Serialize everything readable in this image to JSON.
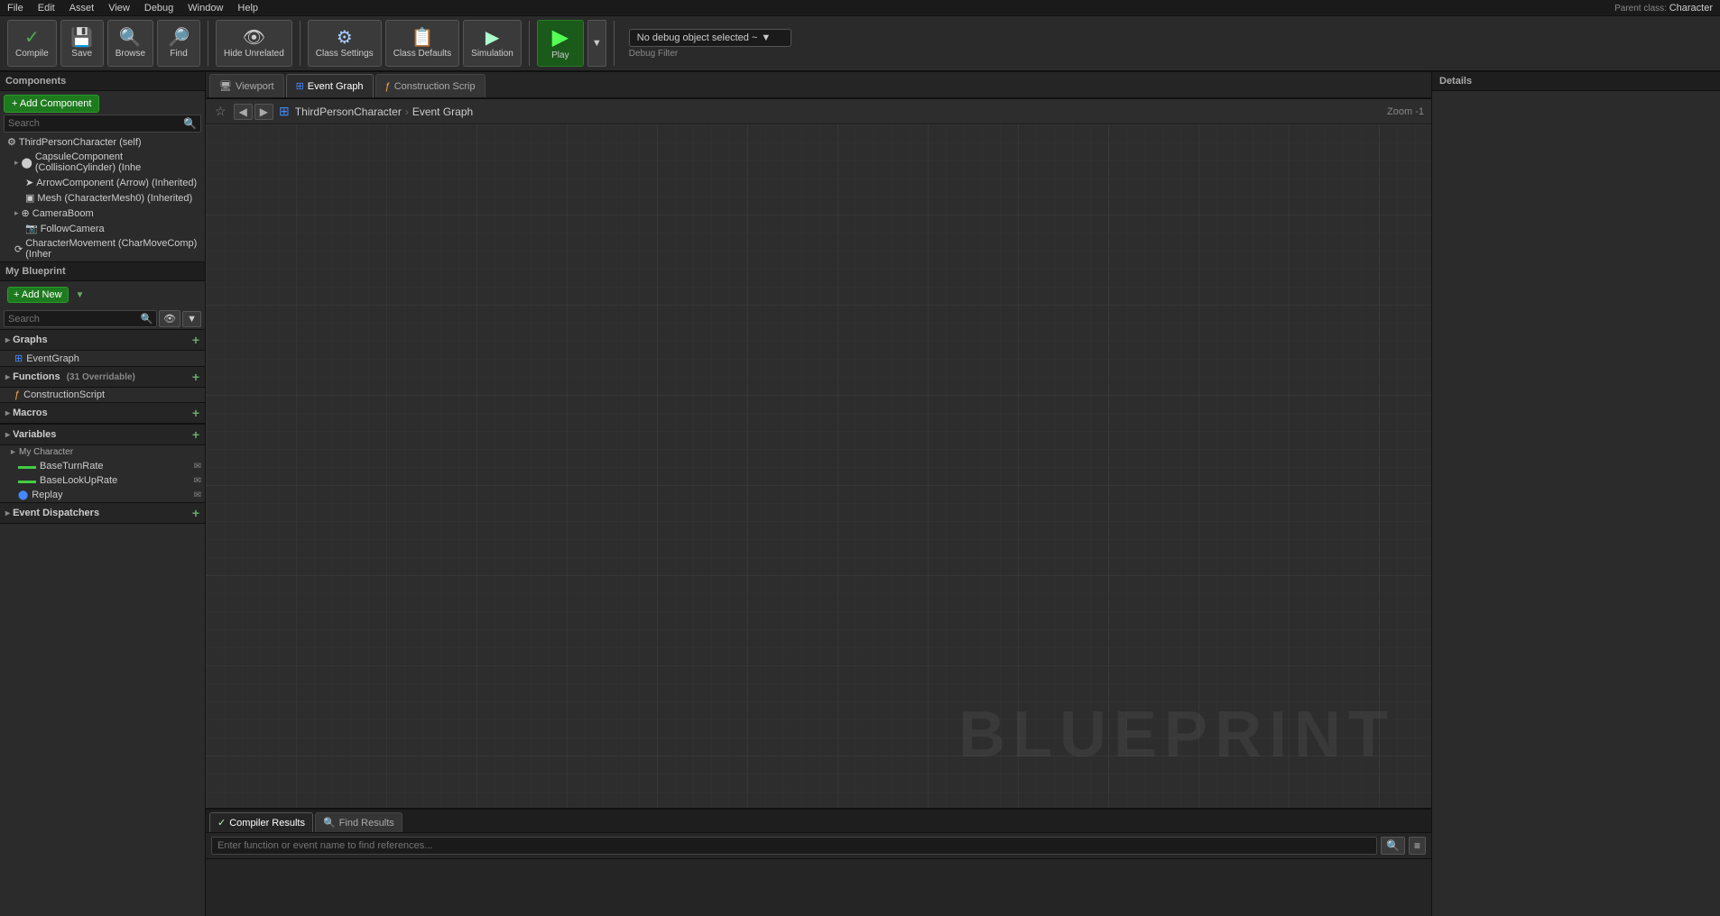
{
  "menubar": {
    "items": [
      "File",
      "Edit",
      "Asset",
      "View",
      "Debug",
      "Window",
      "Help"
    ]
  },
  "toolbar": {
    "compile_label": "Compile",
    "save_label": "Save",
    "browse_label": "Browse",
    "find_label": "Find",
    "hide_unrelated_label": "Hide Unrelated",
    "class_settings_label": "Class Settings",
    "class_defaults_label": "Class Defaults",
    "simulation_label": "Simulation",
    "play_label": "Play",
    "debug_placeholder": "No debug object selected ~",
    "debug_filter_label": "Debug Filter"
  },
  "tabs": {
    "viewport": "Viewport",
    "event_graph": "Event Graph",
    "construction_script": "Construction Scrip"
  },
  "breadcrumb": {
    "class_name": "ThirdPersonCharacter",
    "graph_name": "Event Graph",
    "zoom_label": "Zoom -1"
  },
  "blueprint_watermark": "BLUEPRINT",
  "components": {
    "title": "Components",
    "add_button": "+ Add Component",
    "search_placeholder": "Search",
    "items": [
      {
        "label": "ThirdPersonCharacter (self)",
        "level": 0,
        "icon": "⚙"
      },
      {
        "label": "CapsuleComponent (CollisionCylinder) (Inhe",
        "level": 1,
        "icon": "⬤"
      },
      {
        "label": "ArrowComponent (Arrow) (Inherited)",
        "level": 2,
        "icon": "➤"
      },
      {
        "label": "Mesh (CharacterMesh0) (Inherited)",
        "level": 2,
        "icon": "▣"
      },
      {
        "label": "CameraBoom",
        "level": 1,
        "icon": "⊕"
      },
      {
        "label": "FollowCamera",
        "level": 2,
        "icon": "📷"
      },
      {
        "label": "CharacterMovement (CharMoveComp) (Inher",
        "level": 1,
        "icon": "⟳"
      }
    ]
  },
  "my_blueprint": {
    "title": "My Blueprint",
    "add_new_label": "+ Add New",
    "search_placeholder": "Search",
    "sections": {
      "graphs": {
        "label": "Graphs",
        "items": [
          "EventGraph"
        ]
      },
      "functions": {
        "label": "Functions",
        "count": "(31 Overridable)",
        "items": [
          "ConstructionScript"
        ]
      },
      "macros": {
        "label": "Macros",
        "items": []
      },
      "variables": {
        "label": "Variables",
        "category": "My Character",
        "items": [
          {
            "name": "BaseTurnRate",
            "type": "float",
            "color": "green"
          },
          {
            "name": "BaseLookUpRate",
            "type": "float",
            "color": "green"
          },
          {
            "name": "Replay",
            "type": "object",
            "color": "blue"
          }
        ]
      },
      "event_dispatchers": {
        "label": "Event Dispatchers",
        "items": []
      }
    }
  },
  "bottom_panel": {
    "compiler_results_label": "Compiler Results",
    "find_results_label": "Find Results",
    "find_placeholder": "Enter function or event name to find references..."
  },
  "details_panel": {
    "title": "Details"
  },
  "parent_class": {
    "label": "Parent class:",
    "class_name": "Character"
  }
}
